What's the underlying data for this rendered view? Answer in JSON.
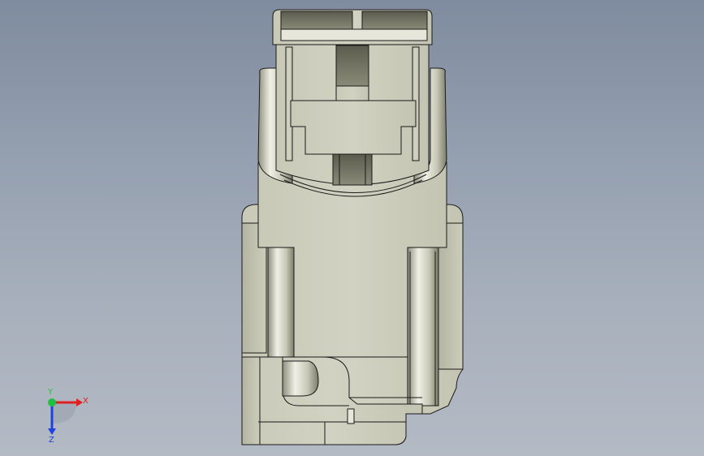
{
  "viewport": {
    "background_top": "#7f8c9f",
    "background_bottom": "#b3bac4",
    "model_color": "#cfcfbf"
  },
  "triad": {
    "x_label": "X",
    "y_label": "Y",
    "z_label": "Z",
    "x_color": "#e02020",
    "y_color": "#20c040",
    "z_color": "#2040e0"
  }
}
